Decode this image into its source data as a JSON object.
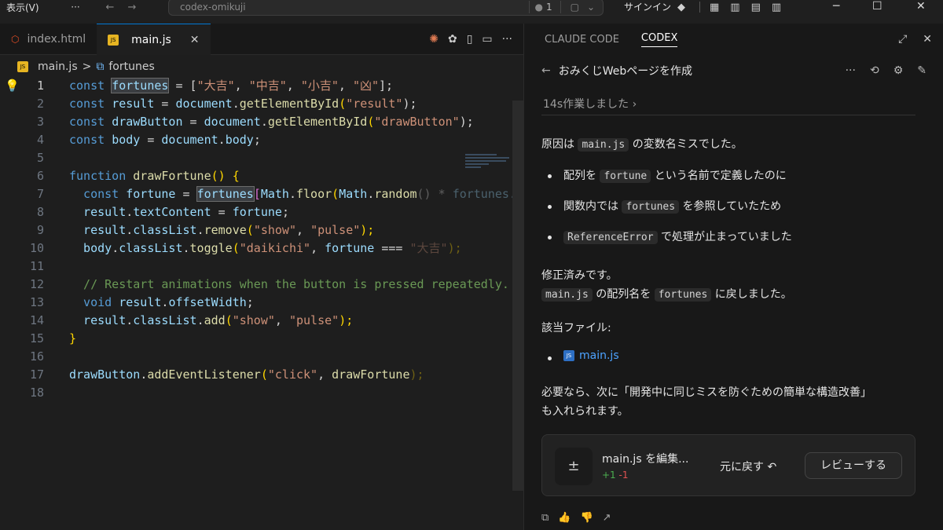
{
  "titlebar": {
    "menu": "表示(V)",
    "more": "···",
    "back_icon": "arrow-left-icon",
    "forward_icon": "arrow-right-icon",
    "search": "codex-omikuji",
    "badge_count": "1",
    "signin": "サインイン"
  },
  "tabs": [
    {
      "label": "index.html",
      "icon": "html-icon"
    },
    {
      "label": "main.js",
      "icon": "js-icon",
      "active": true
    }
  ],
  "breadcrumb": {
    "file": "main.js",
    "sep": ">",
    "symbol": "fortunes"
  },
  "code": {
    "line_numbers": [
      "1",
      "2",
      "3",
      "4",
      "5",
      "6",
      "7",
      "8",
      "9",
      "10",
      "11",
      "12",
      "13",
      "14",
      "15",
      "16",
      "17",
      "18"
    ],
    "l1": {
      "a": "const ",
      "b": "fortunes",
      "c": " = [",
      "d": "\"大吉\"",
      "e": ", ",
      "f": "\"中吉\"",
      "g": ", ",
      "h": "\"小吉\"",
      "i": ", ",
      "j": "\"凶\"",
      "k": "];"
    },
    "l2": {
      "a": "const ",
      "b": "result",
      "c": " = ",
      "d": "document",
      "e": ".",
      "f": "getElementById",
      "g": "(",
      "h": "\"result\"",
      "i": ");"
    },
    "l3": {
      "a": "const ",
      "b": "drawButton",
      "c": " = ",
      "d": "document",
      "e": ".",
      "f": "getElementById",
      "g": "(",
      "h": "\"drawButton\"",
      "i": ");"
    },
    "l4": {
      "a": "const ",
      "b": "body",
      "c": " = ",
      "d": "document",
      "e": ".",
      "f": "body",
      "g": ";"
    },
    "l6": {
      "a": "function ",
      "b": "drawFortune",
      "c": "() ",
      "d": "{"
    },
    "l7": {
      "a": "  const ",
      "b": "fortune",
      "c": " = ",
      "d": "fortunes",
      "e": "[",
      "f": "Math",
      "g": ".",
      "h": "floor",
      "i": "(",
      "j": "Math",
      "k": ".",
      "l": "random",
      "m": "() * ",
      "n": "fortunes.length)];"
    },
    "l8": {
      "a": "  result",
      "b": ".",
      "c": "textContent",
      "d": " = ",
      "e": "fortune",
      "f": ";"
    },
    "l9": {
      "a": "  result",
      "b": ".",
      "c": "classList",
      "d": ".",
      "e": "remove",
      "f": "(",
      "g": "\"show\"",
      "h": ", ",
      "i": "\"pulse\"",
      "j": ");"
    },
    "l10": {
      "a": "  body",
      "b": ".",
      "c": "classList",
      "d": ".",
      "e": "toggle",
      "f": "(",
      "g": "\"daikichi\"",
      "h": ", ",
      "i": "fortune",
      "j": " === ",
      "k": "\"大吉\"",
      "l": ");"
    },
    "l12": {
      "a": "  // Restart animations when the button is pressed repeatedly."
    },
    "l13": {
      "a": "  void ",
      "b": "result",
      "c": ".",
      "d": "offsetWidth",
      "e": ";"
    },
    "l14": {
      "a": "  result",
      "b": ".",
      "c": "classList",
      "d": ".",
      "e": "add",
      "f": "(",
      "g": "\"show\"",
      "h": ", ",
      "i": "\"pulse\"",
      "j": ");"
    },
    "l15": {
      "a": "}"
    },
    "l17": {
      "a": "drawButton",
      "b": ".",
      "c": "addEventListener",
      "d": "(",
      "e": "\"click\"",
      "f": ", ",
      "g": "drawFortune",
      "h": ");"
    }
  },
  "panel": {
    "tab_claude": "CLAUDE CODE",
    "tab_codex": "CODEX",
    "back": "←",
    "title": "おみくじWebページを作成",
    "worked": "14s作業しました",
    "cause_1": "原因は",
    "cause_code": "main.js",
    "cause_2": "の変数名ミスでした。",
    "b1_1": "配列を",
    "b1_code": "fortune",
    "b1_2": "という名前で定義したのに",
    "b2_1": "関数内では",
    "b2_code": "fortunes",
    "b2_2": "を参照していたため",
    "b3_code": "ReferenceError",
    "b3_2": "で処理が止まっていました",
    "fixed": "修正済みです。",
    "fix_code1": "main.js",
    "fix_mid": "の配列名を",
    "fix_code2": "fortunes",
    "fix_end": "に戻しました。",
    "files_label": "該当ファイル:",
    "file_link": "main.js",
    "closing_1": "必要なら、次に「開発中に同じミスを防ぐための簡単な構造改善」",
    "closing_2": "も入れられます。",
    "card_title": "main.js を編集...",
    "card_add": "+1",
    "card_del": "-1",
    "revert": "元に戻す",
    "review": "レビューする"
  },
  "colors": {
    "accent": "#0078d4",
    "add": "#4caf50",
    "del": "#e05252"
  }
}
